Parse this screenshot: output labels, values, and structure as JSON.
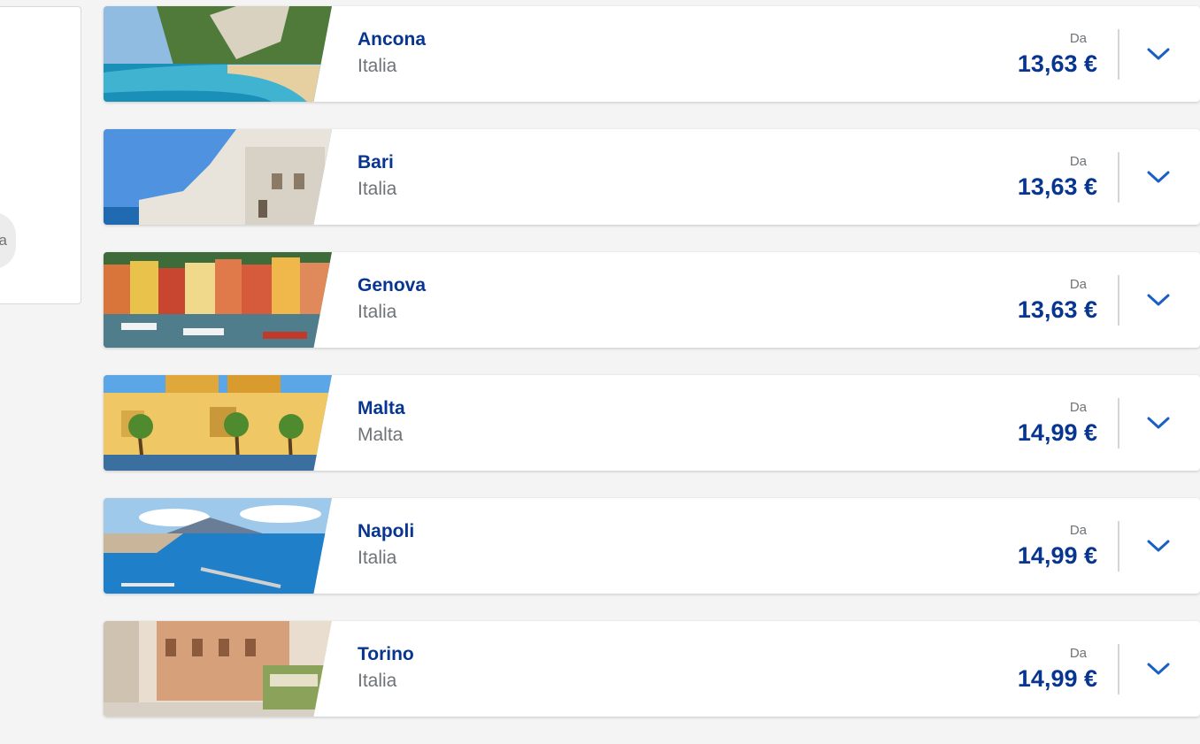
{
  "side_panel": {
    "chip_text": "a"
  },
  "destinations": [
    {
      "city": "Ancona",
      "country": "Italia",
      "from_label": "Da",
      "price": "13,63 €"
    },
    {
      "city": "Bari",
      "country": "Italia",
      "from_label": "Da",
      "price": "13,63 €"
    },
    {
      "city": "Genova",
      "country": "Italia",
      "from_label": "Da",
      "price": "13,63 €"
    },
    {
      "city": "Malta",
      "country": "Malta",
      "from_label": "Da",
      "price": "14,99 €"
    },
    {
      "city": "Napoli",
      "country": "Italia",
      "from_label": "Da",
      "price": "14,99 €"
    },
    {
      "city": "Torino",
      "country": "Italia",
      "from_label": "Da",
      "price": "14,99 €"
    }
  ],
  "icons": {
    "expand": "chevron-down-icon"
  },
  "colors": {
    "brand_blue": "#073590",
    "accent_blue": "#1a5fc4",
    "muted_text": "#6f7377"
  }
}
